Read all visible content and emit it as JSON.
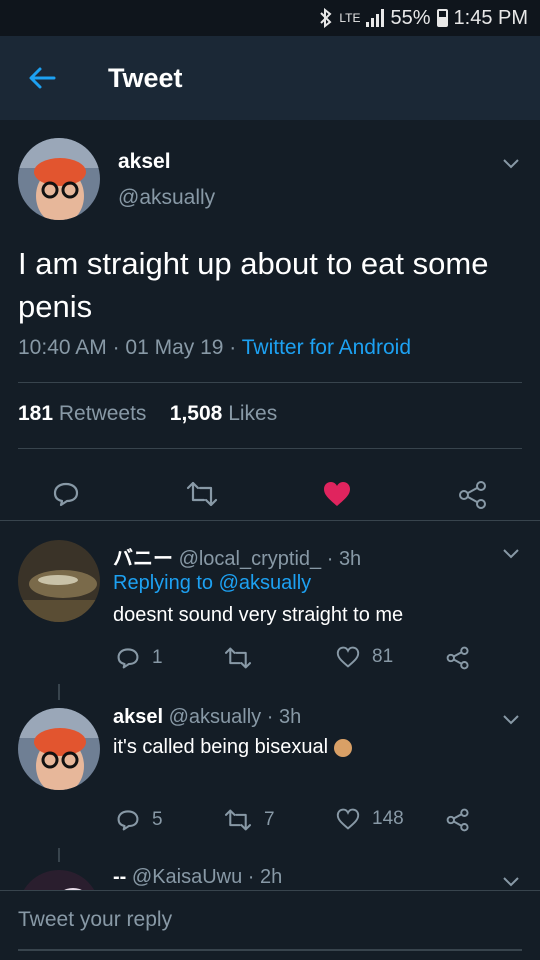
{
  "status_bar": {
    "network": "LTE",
    "battery": "55%",
    "time": "1:45 PM"
  },
  "header": {
    "title": "Tweet"
  },
  "tweet": {
    "name": "aksel",
    "handle": "@aksually",
    "text": "I am straight up about to eat some penis",
    "time": "10:40 AM",
    "date": "01 May 19",
    "client": "Twitter for Android",
    "retweets_count": "181",
    "retweets_label": "Retweets",
    "likes_count": "1,508",
    "likes_label": "Likes",
    "liked": true,
    "like_color": "#e0245e"
  },
  "replies": [
    {
      "name": "バニー",
      "handle": "@local_cryptid_",
      "age": "3h",
      "replying_prefix": "Replying to",
      "replying_to": "@aksually",
      "text": "doesnt sound very straight to me",
      "reply_count": "1",
      "retweet_count": "",
      "like_count": "81"
    },
    {
      "name": "aksel",
      "handle": "@aksually",
      "age": "3h",
      "text": "it's called being bisexual",
      "emoji_icon": "face-emoji-icon",
      "reply_count": "5",
      "retweet_count": "7",
      "like_count": "148"
    },
    {
      "name": "--",
      "handle": "@KaisaUwu",
      "age": "2h"
    }
  ],
  "reply_bar": {
    "placeholder": "Tweet your reply"
  },
  "colors": {
    "accent": "#1da1f2",
    "background": "#141d26",
    "header": "#1b2836",
    "muted": "#8899a6"
  }
}
